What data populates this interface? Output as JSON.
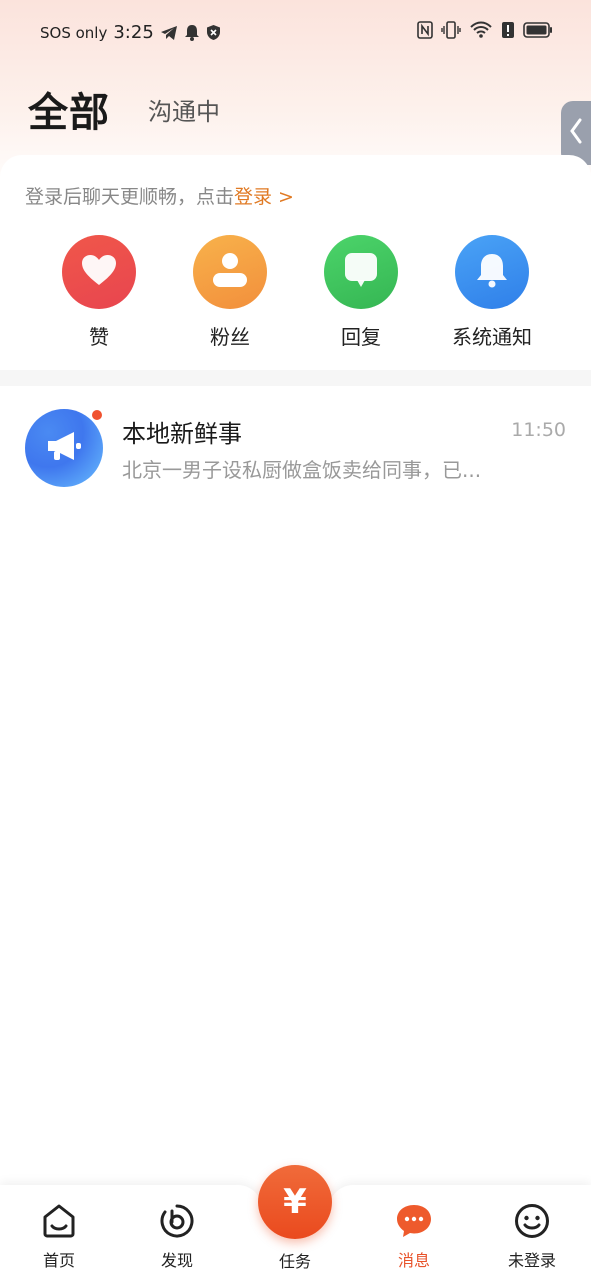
{
  "status_bar": {
    "carrier": "SOS only",
    "time": "3:25"
  },
  "header": {
    "title": "全部",
    "tab": "沟通中"
  },
  "login_tip": {
    "text": "登录后聊天更顺畅，点击",
    "link": "登录 >"
  },
  "quick_actions": [
    {
      "label": "赞",
      "icon": "heart-icon",
      "color": "#ee4b4b"
    },
    {
      "label": "粉丝",
      "icon": "user-icon",
      "color": "#f59a3e"
    },
    {
      "label": "回复",
      "icon": "chat-bubble-icon",
      "color": "#3fbf5c"
    },
    {
      "label": "系统通知",
      "icon": "bell-icon",
      "color": "#3b8df0"
    }
  ],
  "messages": [
    {
      "title": "本地新鲜事",
      "time": "11:50",
      "preview": "北京一男子设私厨做盒饭卖给同事，已...",
      "icon": "megaphone-icon",
      "unread": true
    }
  ],
  "tabbar": {
    "items": [
      {
        "label": "首页",
        "icon": "home-icon"
      },
      {
        "label": "发现",
        "icon": "discover-icon"
      },
      {
        "label": "任务",
        "icon": "yuan-icon"
      },
      {
        "label": "消息",
        "icon": "message-icon",
        "active": true
      },
      {
        "label": "未登录",
        "icon": "smiley-icon"
      }
    ],
    "task_symbol": "¥"
  },
  "colors": {
    "accent": "#e8532b",
    "link": "#e07a24"
  }
}
